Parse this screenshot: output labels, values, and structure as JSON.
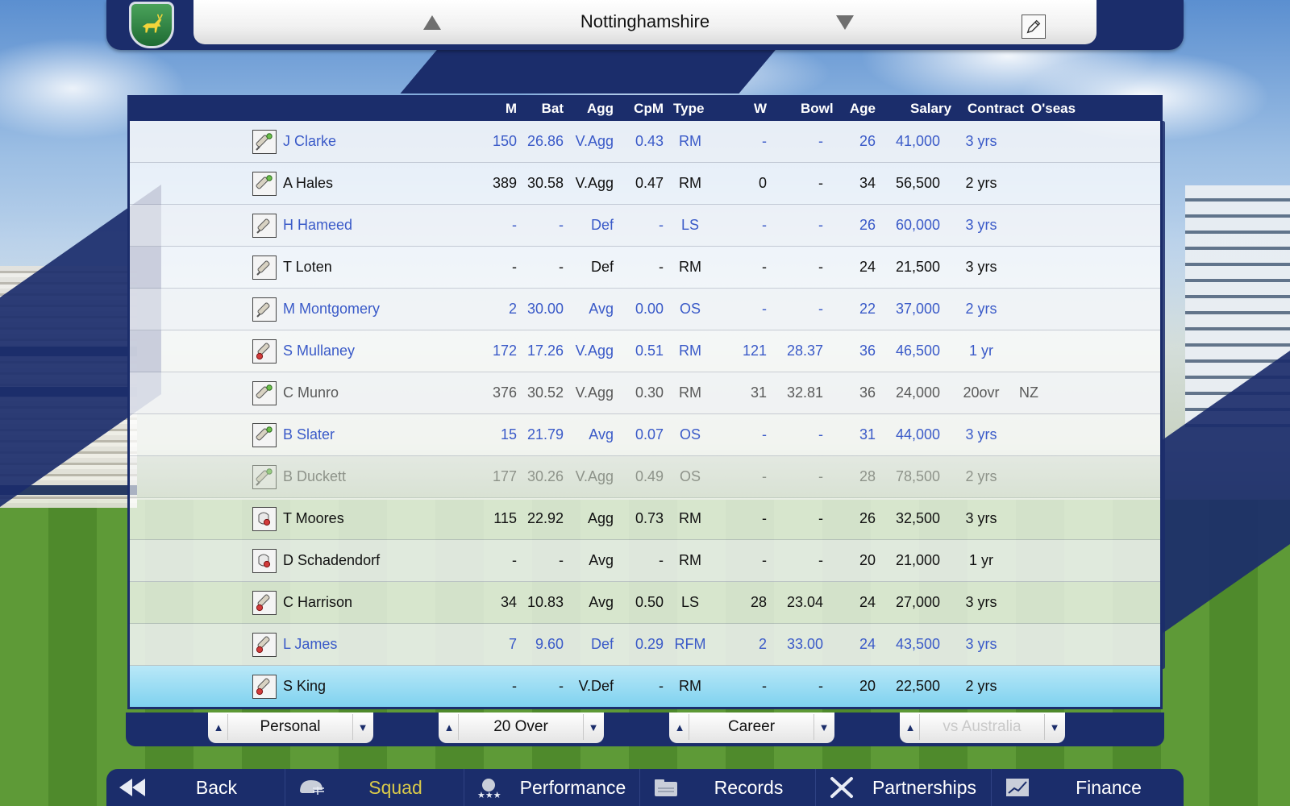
{
  "header": {
    "team_name": "Nottinghamshire"
  },
  "table": {
    "columns": [
      "M",
      "Bat",
      "Agg",
      "CpM",
      "Type",
      "W",
      "Bowl",
      "Age",
      "Salary",
      "Contract",
      "O'seas"
    ],
    "rows": [
      {
        "name": "J Clarke",
        "m": "150",
        "bat": "26.86",
        "agg": "V.Agg",
        "cpm": "0.43",
        "type": "RM",
        "w": "-",
        "bowl": "-",
        "age": "26",
        "salary": "41,000",
        "contract": "3 yrs",
        "oseas": "",
        "style": "blue",
        "icon": "keeper-bat-icon"
      },
      {
        "name": "A Hales",
        "m": "389",
        "bat": "30.58",
        "agg": "V.Agg",
        "cpm": "0.47",
        "type": "RM",
        "w": "0",
        "bowl": "-",
        "age": "34",
        "salary": "56,500",
        "contract": "2 yrs",
        "oseas": "",
        "style": "black",
        "icon": "batsman-icon"
      },
      {
        "name": "H Hameed",
        "m": "-",
        "bat": "-",
        "agg": "Def",
        "cpm": "-",
        "type": "LS",
        "w": "-",
        "bowl": "-",
        "age": "26",
        "salary": "60,000",
        "contract": "3 yrs",
        "oseas": "",
        "style": "blue",
        "icon": "bat-icon"
      },
      {
        "name": "T Loten",
        "m": "-",
        "bat": "-",
        "agg": "Def",
        "cpm": "-",
        "type": "RM",
        "w": "-",
        "bowl": "-",
        "age": "24",
        "salary": "21,500",
        "contract": "3 yrs",
        "oseas": "",
        "style": "black",
        "icon": "bat-icon"
      },
      {
        "name": "M Montgomery",
        "m": "2",
        "bat": "30.00",
        "agg": "Avg",
        "cpm": "0.00",
        "type": "OS",
        "w": "-",
        "bowl": "-",
        "age": "22",
        "salary": "37,000",
        "contract": "2 yrs",
        "oseas": "",
        "style": "blue",
        "icon": "bat-icon"
      },
      {
        "name": "S Mullaney",
        "m": "172",
        "bat": "17.26",
        "agg": "V.Agg",
        "cpm": "0.51",
        "type": "RM",
        "w": "121",
        "bowl": "28.37",
        "age": "36",
        "salary": "46,500",
        "contract": "1 yr",
        "oseas": "",
        "style": "blue",
        "icon": "allrounder-icon"
      },
      {
        "name": "C Munro",
        "m": "376",
        "bat": "30.52",
        "agg": "V.Agg",
        "cpm": "0.30",
        "type": "RM",
        "w": "31",
        "bowl": "32.81",
        "age": "36",
        "salary": "24,000",
        "contract": "20ovr",
        "oseas": "NZ",
        "style": "grey",
        "icon": "batsman-icon"
      },
      {
        "name": "B Slater",
        "m": "15",
        "bat": "21.79",
        "agg": "Avg",
        "cpm": "0.07",
        "type": "OS",
        "w": "-",
        "bowl": "-",
        "age": "31",
        "salary": "44,000",
        "contract": "3 yrs",
        "oseas": "",
        "style": "blue",
        "icon": "batsman-icon"
      },
      {
        "name": "B Duckett",
        "m": "177",
        "bat": "30.26",
        "agg": "V.Agg",
        "cpm": "0.49",
        "type": "OS",
        "w": "-",
        "bowl": "-",
        "age": "28",
        "salary": "78,500",
        "contract": "2 yrs",
        "oseas": "",
        "style": "grey-faded",
        "icon": "keeper-bat-icon"
      },
      {
        "name": "T Moores",
        "m": "115",
        "bat": "22.92",
        "agg": "Agg",
        "cpm": "0.73",
        "type": "RM",
        "w": "-",
        "bowl": "-",
        "age": "26",
        "salary": "32,500",
        "contract": "3 yrs",
        "oseas": "",
        "style": "black",
        "icon": "keeper-icon"
      },
      {
        "name": "D Schadendorf",
        "m": "-",
        "bat": "-",
        "agg": "Avg",
        "cpm": "-",
        "type": "RM",
        "w": "-",
        "bowl": "-",
        "age": "20",
        "salary": "21,000",
        "contract": "1 yr",
        "oseas": "",
        "style": "black",
        "icon": "keeper-icon"
      },
      {
        "name": "C Harrison",
        "m": "34",
        "bat": "10.83",
        "agg": "Avg",
        "cpm": "0.50",
        "type": "LS",
        "w": "28",
        "bowl": "23.04",
        "age": "24",
        "salary": "27,000",
        "contract": "3 yrs",
        "oseas": "",
        "style": "black",
        "icon": "allrounder-icon"
      },
      {
        "name": "L James",
        "m": "7",
        "bat": "9.60",
        "agg": "Def",
        "cpm": "0.29",
        "type": "RFM",
        "w": "2",
        "bowl": "33.00",
        "age": "24",
        "salary": "43,500",
        "contract": "3 yrs",
        "oseas": "",
        "style": "blue",
        "icon": "allrounder-icon"
      },
      {
        "name": "S King",
        "m": "-",
        "bat": "-",
        "agg": "V.Def",
        "cpm": "-",
        "type": "RM",
        "w": "-",
        "bowl": "-",
        "age": "20",
        "salary": "22,500",
        "contract": "2 yrs",
        "oseas": "",
        "style": "black",
        "icon": "allrounder-icon",
        "selected": true
      }
    ]
  },
  "selectors": [
    {
      "label": "Personal",
      "disabled": false
    },
    {
      "label": "20 Over",
      "disabled": false
    },
    {
      "label": "Career",
      "disabled": false
    },
    {
      "label": "vs Australia",
      "disabled": true
    }
  ],
  "nav": [
    {
      "label": "Back",
      "icon": "back-arrows-icon",
      "active": false
    },
    {
      "label": "Squad",
      "icon": "helmet-icon",
      "active": true
    },
    {
      "label": "Performance",
      "icon": "stars-icon",
      "active": false
    },
    {
      "label": "Records",
      "icon": "folder-icon",
      "active": false
    },
    {
      "label": "Partnerships",
      "icon": "crossed-bats-icon",
      "active": false
    },
    {
      "label": "Finance",
      "icon": "chart-icon",
      "active": false
    }
  ],
  "colors": {
    "navy": "#1b2d6b",
    "blue_text": "#3a5ac8",
    "selected_row": "#7fd2ef",
    "active_nav": "#d9c94a"
  }
}
